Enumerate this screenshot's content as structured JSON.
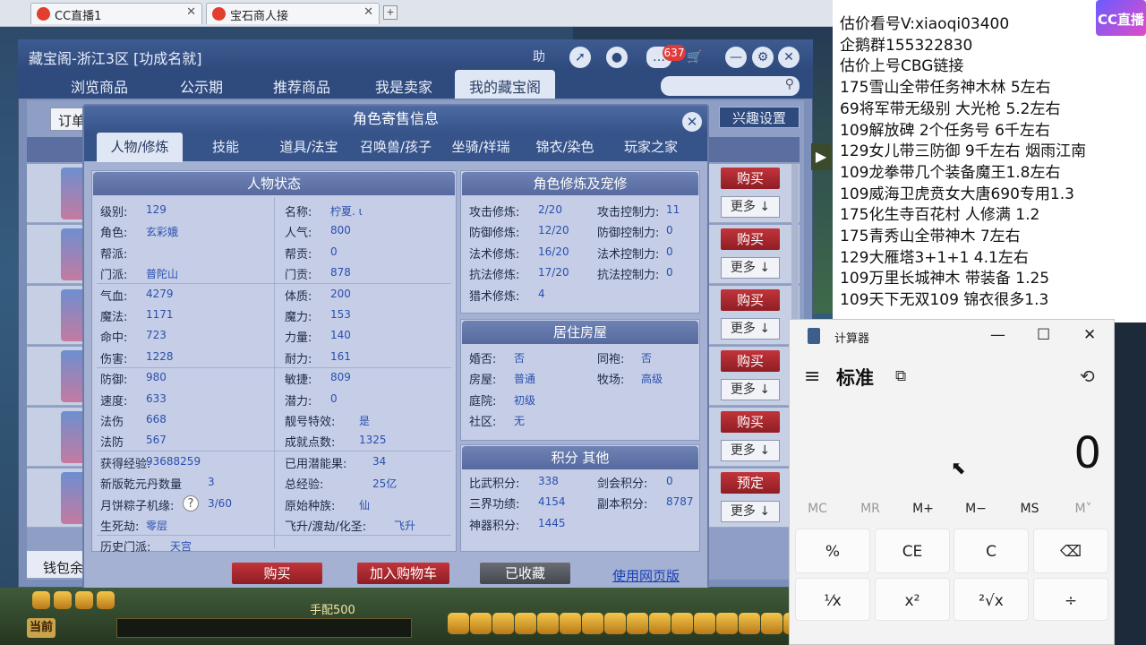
{
  "browser": {
    "tabs": [
      {
        "label": "CC直播1"
      },
      {
        "label": "宝石商人接"
      }
    ],
    "close_glyph": "✕",
    "add_glyph": "+"
  },
  "shop": {
    "title": "藏宝阁-浙江3区 [功成名就]",
    "badge": "637",
    "nav": [
      "浏览商品",
      "公示期",
      "推荐商品",
      "我是卖家",
      "我的藏宝阁"
    ],
    "active_nav": "我的藏宝阁",
    "order_label": "订单",
    "interest_label": "兴趣设置",
    "wallet_label": "钱包余",
    "buy_label": "购买",
    "more_label": "更多 ↓",
    "reserve_label": "预定",
    "icons": {
      "help": "助",
      "settings": "⚙",
      "close": "✕",
      "minimize": "—",
      "cart": "🛒"
    }
  },
  "dialog": {
    "title": "角色寄售信息",
    "close_glyph": "✕",
    "tabs": [
      "人物/修炼",
      "技能",
      "道具/法宝",
      "召唤兽/孩子",
      "坐骑/祥瑞",
      "锦衣/染色",
      "玩家之家"
    ],
    "active_tab": "人物/修炼",
    "status_header": "人物状态",
    "status_left": [
      {
        "label": "级别:",
        "value": "129"
      },
      {
        "label": "角色:",
        "value": "玄彩娥"
      },
      {
        "label": "帮派:",
        "value": ""
      },
      {
        "label": "门派:",
        "value": "普陀山"
      },
      {
        "label": "气血:",
        "value": "4279"
      },
      {
        "label": "魔法:",
        "value": "1171"
      },
      {
        "label": "命中:",
        "value": "723"
      },
      {
        "label": "伤害:",
        "value": "1228"
      },
      {
        "label": "防御:",
        "value": "980"
      },
      {
        "label": "速度:",
        "value": "633"
      },
      {
        "label": "法伤",
        "value": "668"
      },
      {
        "label": "法防",
        "value": "567"
      },
      {
        "label": "获得经验:",
        "value": "93688259"
      },
      {
        "label": "新版乾元丹数量",
        "value": "3"
      },
      {
        "label": "月饼粽子机缘:",
        "value": "3/60"
      },
      {
        "label": "生死劫:",
        "value": "零层"
      },
      {
        "label": "历史门派:",
        "value": "天宫"
      }
    ],
    "status_right": [
      {
        "label": "名称:",
        "value": "柠夏. ι"
      },
      {
        "label": "人气:",
        "value": "800"
      },
      {
        "label": "帮贡:",
        "value": "0"
      },
      {
        "label": "门贡:",
        "value": "878"
      },
      {
        "label": "体质:",
        "value": "200"
      },
      {
        "label": "魔力:",
        "value": "153"
      },
      {
        "label": "力量:",
        "value": "140"
      },
      {
        "label": "耐力:",
        "value": "161"
      },
      {
        "label": "敏捷:",
        "value": "809"
      },
      {
        "label": "潜力:",
        "value": "0"
      },
      {
        "label": "靓号特效:",
        "value": "是"
      },
      {
        "label": "成就点数:",
        "value": "1325"
      },
      {
        "label": "已用潜能果:",
        "value": "34"
      },
      {
        "label": "总经验:",
        "value": "25亿"
      },
      {
        "label": "原始种族:",
        "value": "仙"
      },
      {
        "label": "飞升/渡劫/化圣:",
        "value": "飞升"
      }
    ],
    "qmark": "?",
    "cultivation_header": "角色修炼及宠修",
    "cultivation": [
      {
        "label": "攻击修炼:",
        "value": "2/20",
        "label2": "攻击控制力:",
        "value2": "11"
      },
      {
        "label": "防御修炼:",
        "value": "12/20",
        "label2": "防御控制力:",
        "value2": "0"
      },
      {
        "label": "法术修炼:",
        "value": "16/20",
        "label2": "法术控制力:",
        "value2": "0"
      },
      {
        "label": "抗法修炼:",
        "value": "17/20",
        "label2": "抗法控制力:",
        "value2": "0"
      },
      {
        "label": "猎术修炼:",
        "value": "4",
        "label2": "",
        "value2": ""
      }
    ],
    "house_header": "居住房屋",
    "house": [
      {
        "label": "婚否:",
        "value": "否",
        "label2": "同袍:",
        "value2": "否"
      },
      {
        "label": "房屋:",
        "value": "普通",
        "label2": "牧场:",
        "value2": "高级"
      },
      {
        "label": "庭院:",
        "value": "初级",
        "label2": "",
        "value2": ""
      },
      {
        "label": "社区:",
        "value": "无",
        "label2": "",
        "value2": ""
      }
    ],
    "points_header": "积分 其他",
    "points": [
      {
        "label": "比武积分:",
        "value": "338",
        "label2": "剑会积分:",
        "value2": "0"
      },
      {
        "label": "三界功绩:",
        "value": "4154",
        "label2": "副本积分:",
        "value2": "8787"
      },
      {
        "label": "神器积分:",
        "value": "1445",
        "label2": "",
        "value2": ""
      }
    ],
    "buttons": {
      "buy": "购买",
      "add_cart": "加入购物车",
      "collected": "已收藏",
      "web": "使用网页版"
    }
  },
  "chat": {
    "lines": [
      "估价看号V:xiaoqi03400",
      "企鹅群155322830",
      "估价上号CBG链接",
      "175雪山全带任务神木林 5左右",
      "69将军带无级别 大光枪 5.2左右",
      "109解放碑 2个任务号 6千左右",
      "129女儿带三防御 9千左右 烟雨江南",
      "109龙拳带几个装备魔王1.8左右",
      "109威海卫虎贲女大唐690专用1.3",
      "175化生寺百花村 人修满 1.2",
      "175青秀山全带神木 7左右",
      "129大雁塔3+1+1  4.1左右",
      "109万里长城神木 带装备  1.25",
      "109天下无双109  锦衣很多1.3"
    ],
    "logo": "CC直播"
  },
  "calculator": {
    "title": "计算器",
    "mode": "标准",
    "display": "0",
    "memory": [
      "MC",
      "MR",
      "M+",
      "M−",
      "MS",
      "M˅"
    ],
    "keys_row1": [
      "%",
      "CE",
      "C",
      "⌫"
    ],
    "keys_row2": [
      "¹⁄x",
      "x²",
      "²√x",
      "÷"
    ],
    "controls": {
      "min": "—",
      "max": "☐",
      "close": "✕",
      "menu": "≡",
      "history": "⟲",
      "keep": "⧉"
    }
  },
  "bottombar": {
    "current_label": "当前",
    "hint": "手配500"
  }
}
